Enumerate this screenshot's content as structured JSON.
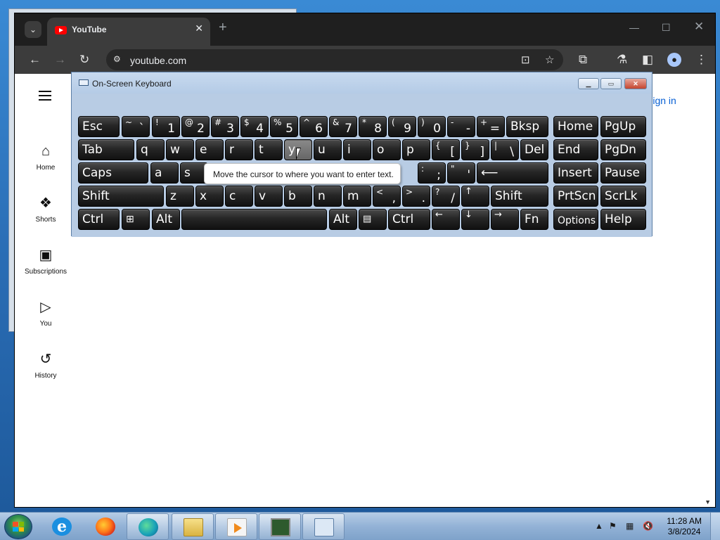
{
  "browser": {
    "tab_title": "YouTube",
    "new_tab_glyph": "+",
    "url": "youtube.com",
    "icons": [
      "tab-search-icon",
      "back-icon",
      "forward-icon",
      "reload-icon",
      "site-info-icon",
      "install-app-icon",
      "bookmark-star-icon",
      "extensions-icon",
      "labs-icon",
      "side-panel-icon",
      "profile-icon",
      "menu-icon"
    ]
  },
  "youtube": {
    "nav": [
      {
        "label": "Home",
        "icon": "home-icon"
      },
      {
        "label": "Shorts",
        "icon": "shorts-icon"
      },
      {
        "label": "Subscriptions",
        "icon": "subscriptions-icon"
      },
      {
        "label": "You",
        "icon": "you-icon"
      },
      {
        "label": "History",
        "icon": "history-icon"
      }
    ],
    "sign_in": "Sign in"
  },
  "osk": {
    "title": "On-Screen Keyboard",
    "tooltip": "Move the cursor to where you want to enter text.",
    "keys": {
      "esc": "Esc",
      "bksp": "Bksp",
      "home": "Home",
      "pgup": "PgUp",
      "tab": "Tab",
      "del": "Del",
      "end": "End",
      "pgdn": "PgDn",
      "caps": "Caps",
      "enter": "⟵",
      "insert": "Insert",
      "pause": "Pause",
      "shift_l": "Shift",
      "shift_r": "Shift",
      "prtscn": "PrtScn",
      "scrlk": "ScrLk",
      "ctrl_l": "Ctrl",
      "alt_l": "Alt",
      "alt_r": "Alt",
      "ctrl_r": "Ctrl",
      "fn": "Fn",
      "options": "Options",
      "help": "Help",
      "up": "↑",
      "left": "←",
      "down": "↓",
      "right": "→",
      "num": [
        {
          "sh": "~",
          "lo": "`"
        },
        {
          "sh": "!",
          "lo": "1"
        },
        {
          "sh": "@",
          "lo": "2"
        },
        {
          "sh": "#",
          "lo": "3"
        },
        {
          "sh": "$",
          "lo": "4"
        },
        {
          "sh": "%",
          "lo": "5"
        },
        {
          "sh": "^",
          "lo": "6"
        },
        {
          "sh": "&",
          "lo": "7"
        },
        {
          "sh": "*",
          "lo": "8"
        },
        {
          "sh": "(",
          "lo": "9"
        },
        {
          "sh": ")",
          "lo": "0"
        },
        {
          "sh": "-",
          "lo": "-"
        },
        {
          "sh": "+",
          "lo": "="
        }
      ],
      "row2": [
        "q",
        "w",
        "e",
        "r",
        "t",
        "y",
        "u",
        "i",
        "o",
        "p"
      ],
      "row2_sym": [
        {
          "sh": "{",
          "lo": "["
        },
        {
          "sh": "}",
          "lo": "]"
        },
        {
          "sh": "|",
          "lo": "\\"
        }
      ],
      "row3": [
        "a",
        "s"
      ],
      "row3_sym": [
        {
          "sh": ":",
          "lo": ";"
        },
        {
          "sh": "\"",
          "lo": "'"
        }
      ],
      "row4": [
        "z",
        "x",
        "c",
        "v",
        "b",
        "n",
        "m"
      ],
      "row4_sym": [
        {
          "sh": "<",
          "lo": ","
        },
        {
          "sh": ">",
          "lo": "."
        },
        {
          "sh": "?",
          "lo": "/"
        }
      ]
    }
  },
  "taskbar": {
    "apps": [
      "start-button",
      "internet-explorer",
      "firefox",
      "edge",
      "file-explorer",
      "media-player",
      "resource-monitor",
      "on-screen-keyboard"
    ],
    "clock_time": "11:28 AM",
    "clock_date": "3/8/2024",
    "tray_icons": [
      "tray-arrow-icon",
      "action-center-flag-icon",
      "network-icon",
      "volume-muted-icon"
    ]
  }
}
